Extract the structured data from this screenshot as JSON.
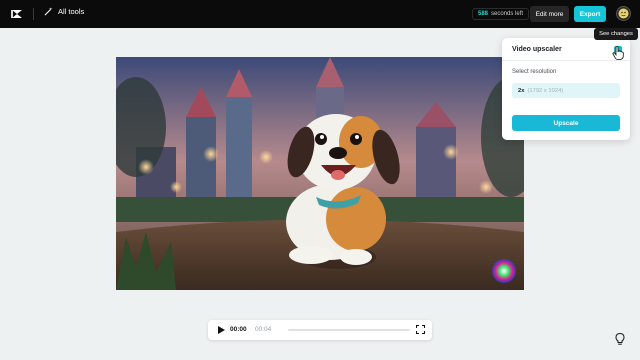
{
  "header": {
    "all_tools_label": "All tools",
    "timer_value": "588",
    "timer_suffix": "seconds left",
    "edit_more_label": "Edit more",
    "export_label": "Export"
  },
  "panel": {
    "title": "Video upscaler",
    "resolution_label": "Select resolution",
    "resolution_value": "2x",
    "resolution_detail": "(1792 x 1024)",
    "upscale_label": "Upscale"
  },
  "tooltip": {
    "text": "See changes"
  },
  "player": {
    "current_time": "00:00",
    "total_time": "00:04",
    "progress": 0
  },
  "colors": {
    "accent": "#16c6d8",
    "topbar": "#0b0b0b",
    "canvas": "#eef1f1"
  },
  "icons": {
    "logo": "capcut-logo-icon",
    "tools": "magic-wand-icon",
    "play": "play-icon",
    "fullscreen": "fullscreen-icon",
    "help": "lightbulb-icon",
    "cursor": "hand-pointer-icon"
  }
}
